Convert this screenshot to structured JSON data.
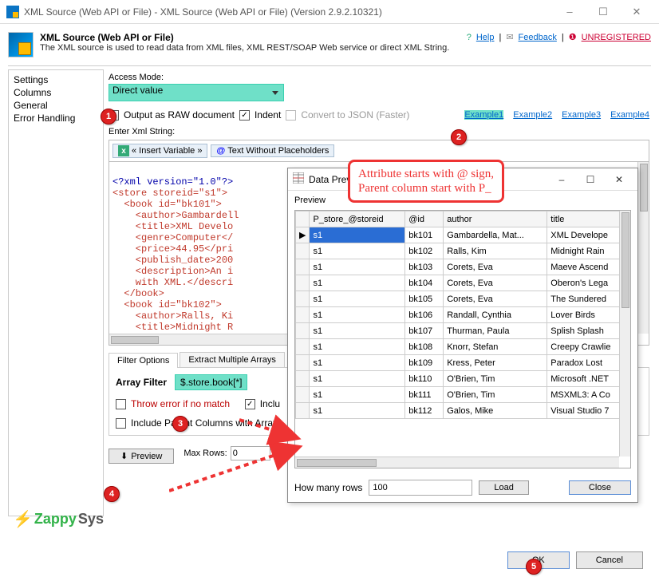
{
  "titlebar": {
    "text": "XML Source (Web API or File) - XML Source (Web API or File) (Version 2.9.2.10321)"
  },
  "header": {
    "title": "XML Source (Web API or File)",
    "subtitle": "The XML source is used to read data from XML files, XML REST/SOAP Web service or direct XML String.",
    "help": "Help",
    "feedback": "Feedback",
    "unregistered": "UNREGISTERED "
  },
  "sidebar": {
    "items": [
      "Settings",
      "Columns",
      "General",
      "Error Handling"
    ]
  },
  "access": {
    "label": "Access Mode:",
    "value": "Direct value"
  },
  "checks": {
    "raw": "Output as RAW document",
    "indent": "Indent",
    "convert": "Convert to JSON (Faster)"
  },
  "examples": [
    "Example1",
    "Example2",
    "Example3",
    "Example4"
  ],
  "toolbar": {
    "insert": "« Insert Variable »",
    "textwo": "Text Without Placeholders"
  },
  "xml_label": "Enter Xml String:",
  "xml_lines": [
    {
      "decl": "<?xml version=\"1.0\"?>"
    },
    {
      "open": "<store storeid=\"s1\">"
    },
    {
      "open": "  <book id=\"bk101\">"
    },
    {
      "pair": "    <author>Gambardell"
    },
    {
      "pair": "    <title>XML Develo"
    },
    {
      "pair": "    <genre>Computer</"
    },
    {
      "pair": "    <price>44.95</pri"
    },
    {
      "pair": "    <publish_date>200"
    },
    {
      "open": "    <description>An i"
    },
    {
      "pair": "    with XML.</descri"
    },
    {
      "close": "  </book>"
    },
    {
      "open": "  <book id=\"bk102\">"
    },
    {
      "pair": "    <author>Ralls, Ki"
    },
    {
      "pair": "    <title>Midnight R"
    }
  ],
  "tabs": {
    "filter": "Filter Options",
    "extract": "Extract Multiple Arrays"
  },
  "filter": {
    "label": "Array Filter",
    "value": "$.store.book[*]",
    "throw": "Throw error if no match",
    "include": "Inclu",
    "includeparent": "Include Parent Columns with Array"
  },
  "preview_btn": "Preview",
  "maxrows": {
    "label": "Max Rows:",
    "value": "0"
  },
  "footer": {
    "ok": "OK",
    "cancel": "Cancel"
  },
  "dlg": {
    "title": "Data Preview",
    "section": "Preview",
    "columns": [
      "P_store_@storeid",
      "@id",
      "author",
      "title"
    ],
    "rows": [
      [
        "s1",
        "bk101",
        "Gambardella, Mat...",
        "XML Develope"
      ],
      [
        "s1",
        "bk102",
        "Ralls, Kim",
        "Midnight Rain"
      ],
      [
        "s1",
        "bk103",
        "Corets, Eva",
        "Maeve Ascend"
      ],
      [
        "s1",
        "bk104",
        "Corets, Eva",
        "Oberon's Lega"
      ],
      [
        "s1",
        "bk105",
        "Corets, Eva",
        "The Sundered"
      ],
      [
        "s1",
        "bk106",
        "Randall, Cynthia",
        "Lover Birds"
      ],
      [
        "s1",
        "bk107",
        "Thurman, Paula",
        "Splish Splash"
      ],
      [
        "s1",
        "bk108",
        "Knorr, Stefan",
        "Creepy Crawlie"
      ],
      [
        "s1",
        "bk109",
        "Kress, Peter",
        "Paradox Lost"
      ],
      [
        "s1",
        "bk110",
        "O'Brien, Tim",
        "Microsoft .NET"
      ],
      [
        "s1",
        "bk111",
        "O'Brien, Tim",
        "MSXML3: A Co"
      ],
      [
        "s1",
        "bk112",
        "Galos, Mike",
        "Visual Studio 7"
      ]
    ],
    "howmany_label": "How many rows",
    "howmany": "100",
    "load": "Load",
    "close": "Close"
  },
  "callout": {
    "line1": "Attribute starts with @ sign,",
    "line2": "Parent column start with P_"
  },
  "logo": {
    "z": "Zappy",
    "sys": "Sys"
  }
}
